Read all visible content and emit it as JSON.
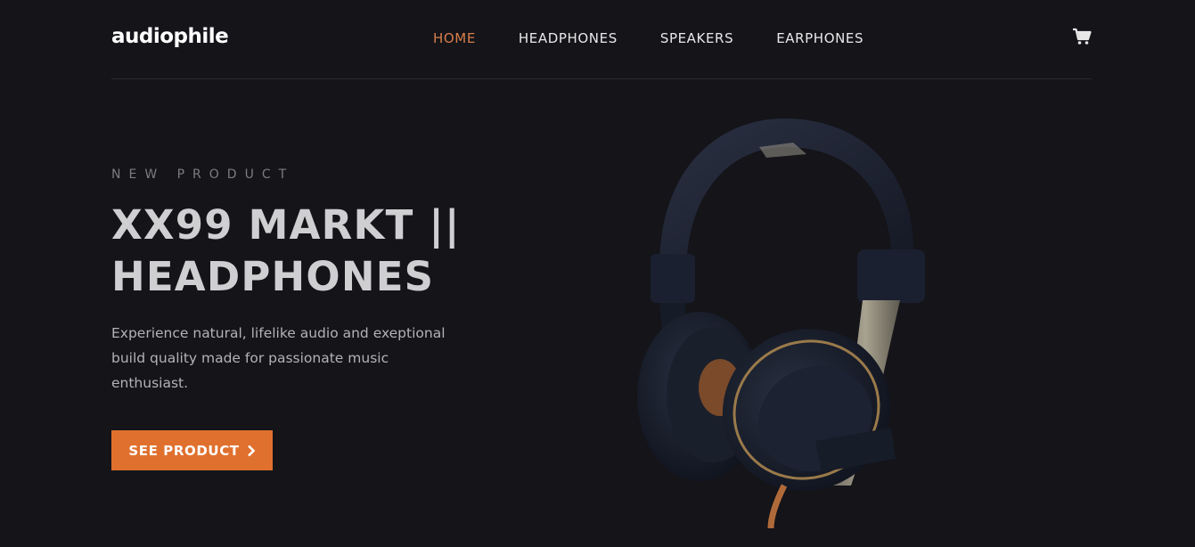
{
  "header": {
    "logo": "audiophile",
    "nav": [
      {
        "label": "HOME",
        "active": true
      },
      {
        "label": "HEADPHONES",
        "active": false
      },
      {
        "label": "SPEAKERS",
        "active": false
      },
      {
        "label": "EARPHONES",
        "active": false
      }
    ],
    "cart_icon": "cart-icon"
  },
  "hero": {
    "overline": "NEW PRODUCT",
    "title_line1": "XX99 MARKT ||",
    "title_line2": "HEADPHONES",
    "description": "Experience natural, lifelike audio and exeptional build quality made for passionate music enthusiast.",
    "cta_label": "SEE PRODUCT",
    "cta_icon": "chevron-right-icon",
    "image": "headphones-image"
  },
  "colors": {
    "background": "#141419",
    "accent": "#d87d4a",
    "button": "#e0702e"
  }
}
